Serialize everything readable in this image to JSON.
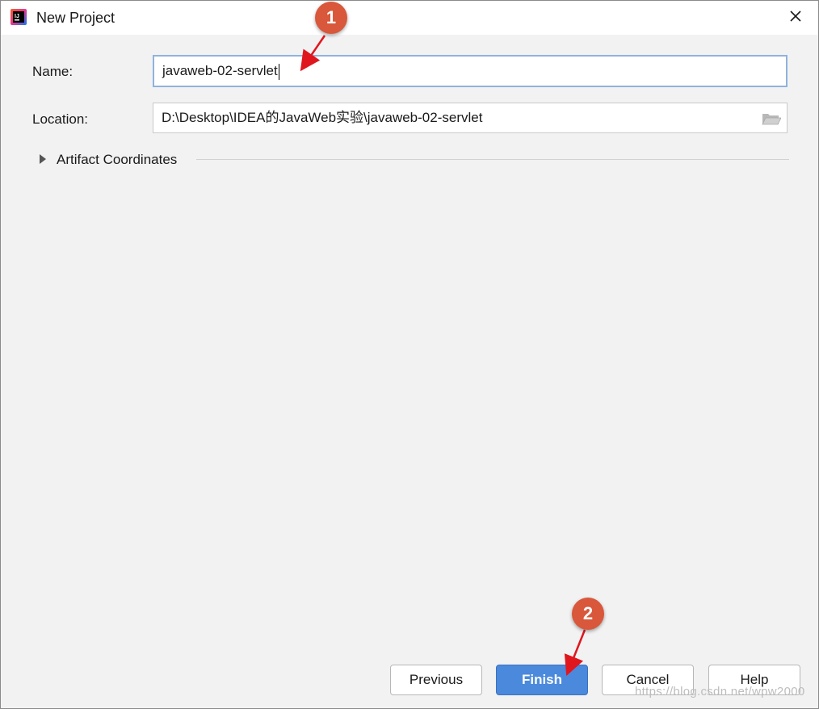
{
  "window": {
    "title": "New Project",
    "app_icon": "intellij-idea-icon",
    "close_icon": "close-icon"
  },
  "form": {
    "name_label": "Name:",
    "name_value": "javaweb-02-servlet",
    "location_label": "Location:",
    "location_value": "D:\\Desktop\\IDEA的JavaWeb实验\\javaweb-02-servlet",
    "location_browse_icon": "folder-icon"
  },
  "artifact": {
    "label": "Artifact Coordinates",
    "expand_icon": "triangle-right-icon"
  },
  "buttons": {
    "previous": "Previous",
    "finish": "Finish",
    "cancel": "Cancel",
    "help": "Help"
  },
  "annotations": {
    "badge1": "1",
    "badge2": "2",
    "color": "#d9573b",
    "arrow_color": "#e0161f"
  },
  "watermark": "https://blog.csdn.net/wpw2000",
  "colors": {
    "accent": "#4a89dc",
    "focus_border": "#8fb3dd",
    "dialog_bg": "#f2f2f2"
  }
}
